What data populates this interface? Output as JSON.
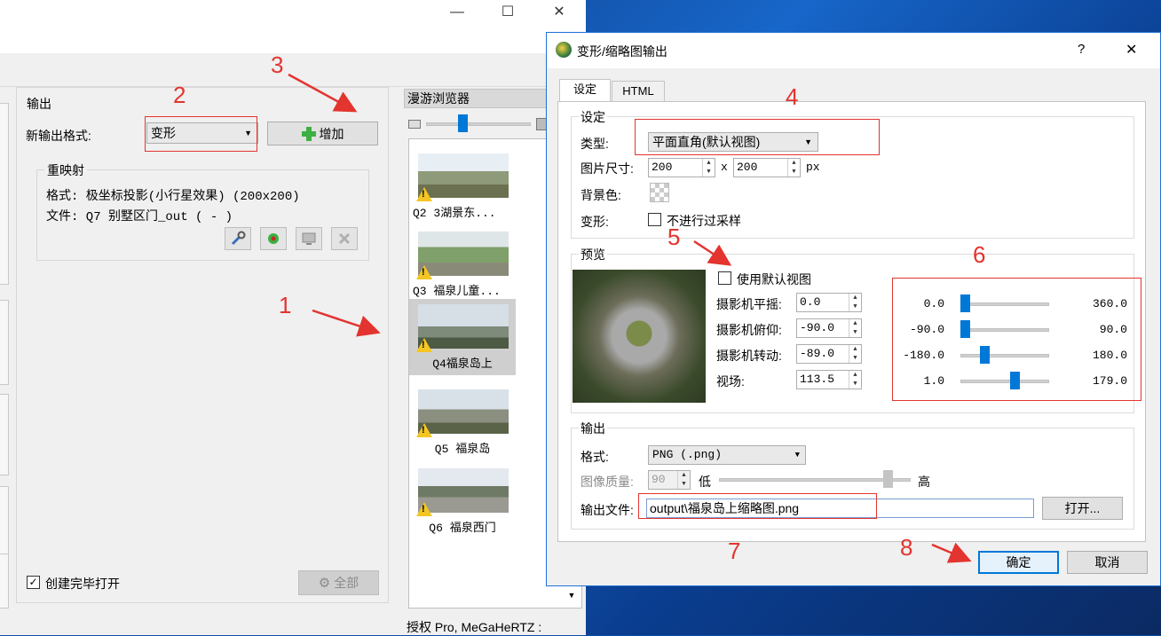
{
  "window_controls": {
    "minimize": "—",
    "maximize": "☐",
    "close": "✕"
  },
  "output_panel": {
    "title": "输出",
    "new_format_label": "新输出格式:",
    "format_value": "变形",
    "add_button": "增加",
    "remap": {
      "title": "重映射",
      "format_line": "格式: 极坐标投影(小行星效果) (200x200)",
      "file_line": "文件: Q7 别墅区门_out ( - )"
    },
    "open_when_done_label": "创建完毕打开",
    "open_when_done_checked": true,
    "all_button": "全部"
  },
  "browser": {
    "title": "漫游浏览器",
    "items": [
      {
        "caption": "Q2  3湖景东...",
        "selected": false
      },
      {
        "caption": "Q3 福泉儿童...",
        "selected": false
      },
      {
        "caption": "Q4福泉岛上",
        "selected": true
      },
      {
        "caption": "Q5 福泉岛",
        "selected": false
      },
      {
        "caption": "Q6 福泉西门",
        "selected": false
      }
    ]
  },
  "status_bar": "授权 Pro, MeGaHeRTZ :",
  "dialog": {
    "title": "变形/缩略图输出",
    "help": "?",
    "close": "✕",
    "tabs": [
      "设定",
      "HTML"
    ],
    "settings": {
      "title": "设定",
      "type_label": "类型:",
      "type_value": "平面直角(默认视图)",
      "size_label": "图片尺寸:",
      "width": "200",
      "x_sep": "x",
      "height": "200",
      "unit": "px",
      "bg_label": "背景色:",
      "transform_label": "变形:",
      "no_oversample_label": "不进行过采样",
      "no_oversample_checked": false
    },
    "preview": {
      "title": "预览",
      "use_default_view_label": "使用默认视图",
      "use_default_view_checked": false,
      "params": [
        {
          "label": "摄影机平摇:",
          "value": "0.0",
          "min": "0.0",
          "max": "360.0",
          "fraction": 0.0
        },
        {
          "label": "摄影机俯仰:",
          "value": "-90.0",
          "min": "-90.0",
          "max": "90.0",
          "fraction": 0.0
        },
        {
          "label": "摄影机转动:",
          "value": "-89.0",
          "min": "-180.0",
          "max": "180.0",
          "fraction": 0.25
        },
        {
          "label": "视场:",
          "value": "113.5",
          "min": "1.0",
          "max": "179.0",
          "fraction": 0.63
        }
      ]
    },
    "output": {
      "title": "输出",
      "format_label": "格式:",
      "format_value": "PNG (.png)",
      "quality_label": "图像质量:",
      "quality_value": "90",
      "quality_low": "低",
      "quality_high": "高",
      "quality_fraction": 0.9,
      "file_label": "输出文件:",
      "file_value": "output\\福泉岛上缩略图.png",
      "open_button": "打开..."
    },
    "ok_button": "确定",
    "cancel_button": "取消"
  },
  "annotations": [
    "1",
    "2",
    "3",
    "4",
    "5",
    "6",
    "7",
    "8"
  ],
  "colors": {
    "annotation": "#e3342f",
    "accent": "#0078d7",
    "warning": "#f3c623"
  }
}
